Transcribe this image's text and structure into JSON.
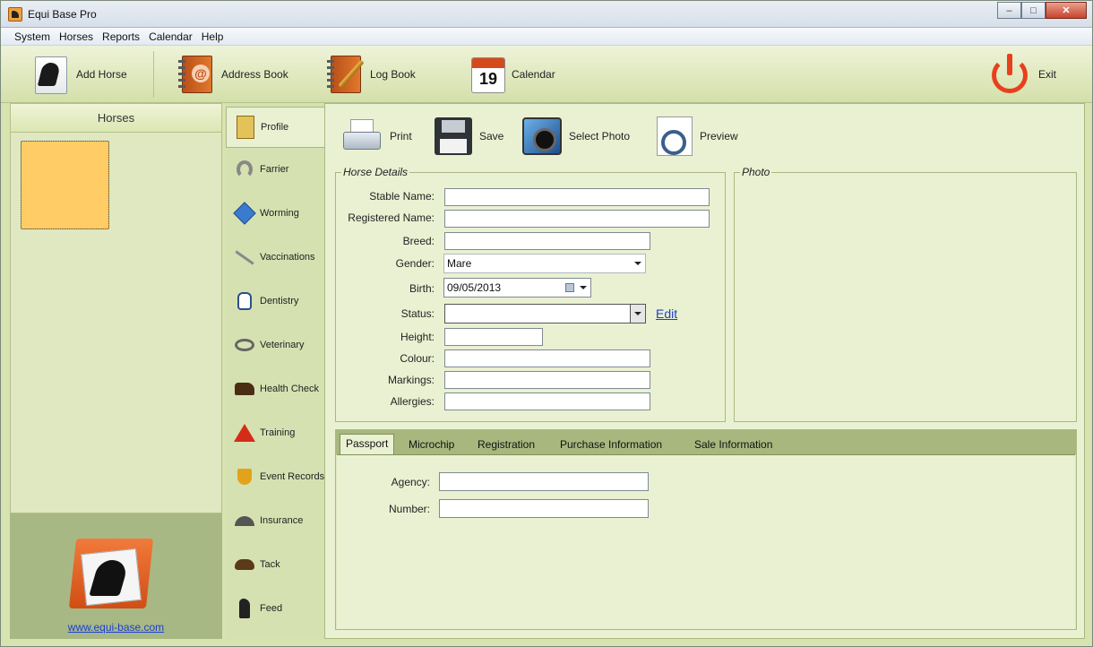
{
  "window": {
    "title": "Equi Base Pro",
    "buttons": {
      "minimize": "–",
      "maximize": "□",
      "close": "✕"
    }
  },
  "menu": {
    "items": [
      "System",
      "Horses",
      "Reports",
      "Calendar",
      "Help"
    ]
  },
  "toolbar": {
    "add_horse": "Add Horse",
    "address_book": "Address Book",
    "log_book": "Log Book",
    "calendar": "Calendar",
    "calendar_day": "19",
    "exit": "Exit"
  },
  "horses_panel": {
    "title": "Horses"
  },
  "logo": {
    "link": "www.equi-base.com"
  },
  "nav": {
    "items": [
      "Profile",
      "Farrier",
      "Worming",
      "Vaccinations",
      "Dentistry",
      "Veterinary",
      "Health Check",
      "Training",
      "Event Records",
      "Insurance",
      "Tack",
      "Feed"
    ]
  },
  "content_toolbar": {
    "print": "Print",
    "save": "Save",
    "select_photo": "Select Photo",
    "preview": "Preview"
  },
  "horse_details": {
    "legend": "Horse Details",
    "labels": {
      "stable_name": "Stable Name:",
      "registered_name": "Registered Name:",
      "breed": "Breed:",
      "gender": "Gender:",
      "birth": "Birth:",
      "status": "Status:",
      "height": "Height:",
      "colour": "Colour:",
      "markings": "Markings:",
      "allergies": "Allergies:"
    },
    "values": {
      "stable_name": "",
      "registered_name": "",
      "breed": "",
      "gender": "Mare",
      "birth": "09/05/2013",
      "status": "",
      "height": "",
      "colour": "",
      "markings": "",
      "allergies": ""
    },
    "edit_link": "Edit"
  },
  "photo": {
    "legend": "Photo"
  },
  "tabs": {
    "items": [
      "Passport",
      "Microchip",
      "Registration",
      "Purchase Information",
      "Sale Information"
    ],
    "active": "Passport",
    "passport": {
      "agency_label": "Agency:",
      "number_label": "Number:",
      "agency_value": "",
      "number_value": ""
    }
  }
}
